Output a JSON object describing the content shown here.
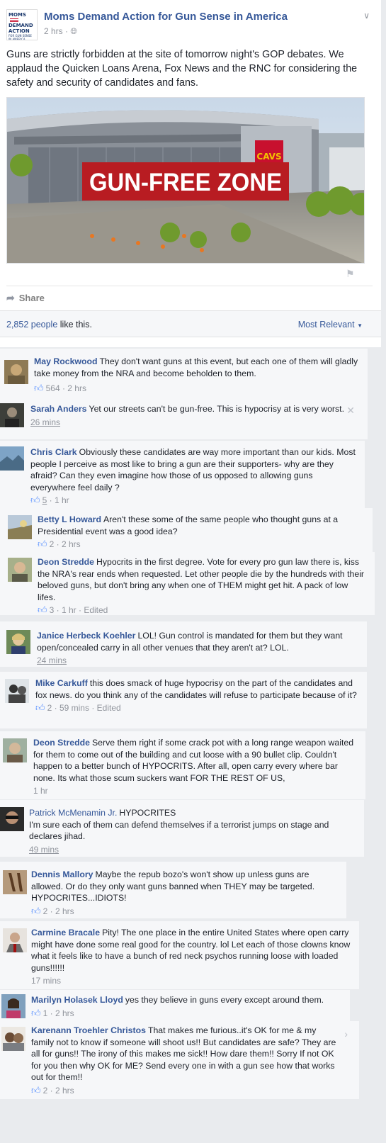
{
  "post": {
    "page_name": "Moms Demand Action for Gun Sense in America",
    "time": "2 hrs",
    "privacy_icon": "globe-icon",
    "logo_lines": [
      "MOMS",
      "DEMAND",
      "ACTION",
      "FOR GUN SENSE IN AMERICA"
    ],
    "text": "Guns are strictly forbidden at the site of tomorrow night's GOP debates. We applaud the Quicken Loans Arena, Fox News and the RNC for considering the safety and security of candidates and fans.",
    "image_banner": "GUN-FREE ZONE",
    "arena_sign": "CAVS",
    "share_label": "Share",
    "likes_count": "2,852 people",
    "likes_suffix": " like this.",
    "sort_label": "Most Relevant"
  },
  "comments": [
    {
      "name": "May Rockwood",
      "text": "They don't want guns at this event, but each one of them will gladly take money from the NRA and become beholden to them.",
      "likes": "564",
      "time": "2 hrs",
      "edited": ""
    },
    {
      "name": "Sarah Anders",
      "text": "Yet our streets can't be gun-free. This is hypocrisy at is very worst.",
      "likes": "",
      "time": "26 mins",
      "edited": ""
    },
    {
      "name": "Chris Clark",
      "text": "Obviously these candidates are way more important than our kids. Most people I perceive as most like to bring a gun are their supporters- why are they afraid? Can they even imagine how those of us opposed to allowing guns everywhere feel daily ?",
      "likes": "5",
      "time": "1 hr",
      "edited": ""
    },
    {
      "name": "Betty L Howard",
      "text": "Aren't these some of the same people who thought guns at a Presidential event was a good idea?",
      "likes": "2",
      "time": "2 hrs",
      "edited": ""
    },
    {
      "name": "Deon Stredde",
      "text": "Hypocrits in the first degree. Vote for every pro gun law there is, kiss the NRA's rear ends when requested. Let other people die by the hundreds with their beloved guns, but don't bring any when one of THEM might get hit. A pack of low lifes.",
      "likes": "3",
      "time": "1 hr",
      "edited": "Edited"
    },
    {
      "name": "Janice Herbeck Koehler",
      "text": "LOL! Gun control is mandated for them but they want open/concealed carry in all other venues that they aren't at? LOL.",
      "likes": "",
      "time": "24 mins",
      "edited": ""
    },
    {
      "name": "Mike Carkuff",
      "text": "this does smack of huge hypocrisy on the part of the candidates and fox news. do you think any of the candidates will refuse to participate because of it?",
      "likes": "2",
      "time": "59 mins",
      "edited": "Edited"
    },
    {
      "name": "Deon Stredde",
      "text": "Serve them right if some crack pot with a long range weapon waited for them to come out of the building and cut loose with a 90 bullet clip. Couldn't happen to a better bunch of HYPOCRITS. After all, open carry every where bar none. Its what those scum suckers want FOR THE REST OF US,",
      "likes": "",
      "time": "1 hr",
      "edited": ""
    },
    {
      "name": "Patrick McMenamin Jr.",
      "text": "HYPOCRITES\nI'm sure each of them can defend themselves if a terrorist jumps on stage and declares jihad.",
      "likes": "",
      "time": "49 mins",
      "edited": ""
    },
    {
      "name": "Dennis Mallory",
      "text": "Maybe the repub bozo's won't show up unless guns are allowed. Or do they only want guns banned when THEY may be targeted. HYPOCRITES...IDIOTS!",
      "likes": "2",
      "time": "2 hrs",
      "edited": ""
    },
    {
      "name": "Carmine Bracale",
      "text": "Pity! The one place in the entire United States where open carry might have done some real good for the country. lol Let each of those clowns know what it feels like to have a bunch of red neck psychos running loose with loaded guns!!!!!!",
      "likes": "",
      "time": "17 mins",
      "edited": ""
    },
    {
      "name": "Marilyn Holasek Lloyd",
      "text": "yes they believe in guns every except around them.",
      "likes": "1",
      "time": "2 hrs",
      "edited": ""
    },
    {
      "name": "Karenann Troehler Christos",
      "text": "That makes me furious..it's OK for me & my family not to know if someone will shoot us!! But candidates are safe? They are all for guns!! The irony of this makes me sick!! How dare them!! Sorry If not OK for you then why OK for ME? Send every one in with a gun see how that works out for them!!",
      "likes": "2",
      "time": "2 hrs",
      "edited": ""
    }
  ],
  "colors": {
    "link": "#365899",
    "banner": "#b81c22",
    "meta": "#90949c"
  }
}
